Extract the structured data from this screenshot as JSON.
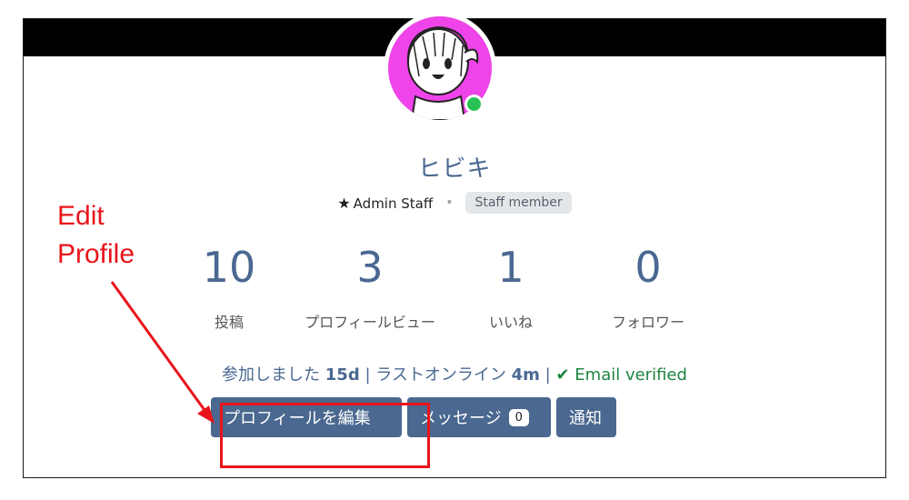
{
  "profile": {
    "username": "ヒビキ",
    "role_label": "Admin Staff",
    "badge": "Staff member",
    "online": true
  },
  "stats": [
    {
      "value": "10",
      "label": "投稿"
    },
    {
      "value": "3",
      "label": "プロフィールビュー"
    },
    {
      "value": "1",
      "label": "いいね"
    },
    {
      "value": "0",
      "label": "フォロワー"
    }
  ],
  "joined": {
    "prefix": "参加しました",
    "joined_value": "15d",
    "separator": "|",
    "last_online_label": "ラストオンライン",
    "last_online_value": "4m",
    "verified_label": "Email verified"
  },
  "actions": {
    "edit_profile": "プロフィールを編集",
    "message": "メッセージ",
    "message_count": "0",
    "notify": "通知"
  },
  "annotation": {
    "line1": "Edit",
    "line2": "Profile",
    "color": "#e8141a"
  },
  "colors": {
    "accent": "#4a6891",
    "avatar_bg": "#ee44e9",
    "online": "#2ac255",
    "verified": "#1e8541"
  },
  "icons": {
    "role": "star-icon",
    "verified": "check-icon"
  }
}
